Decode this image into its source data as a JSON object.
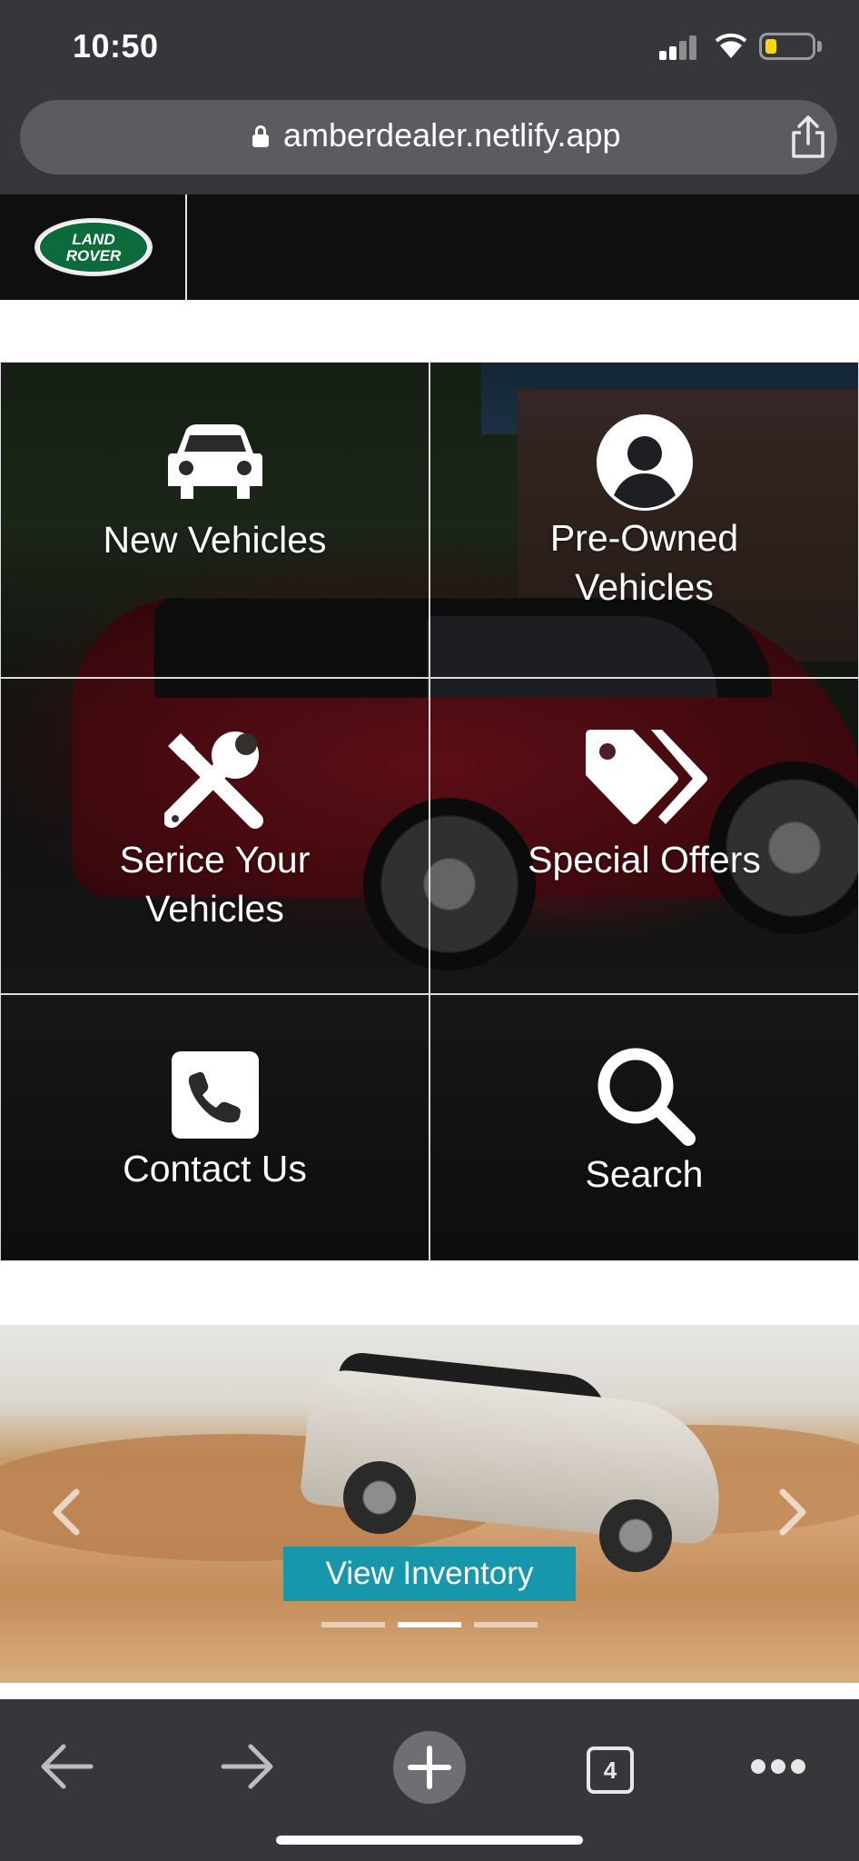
{
  "status_bar": {
    "time": "10:50",
    "battery_color": "#f5d90a"
  },
  "browser": {
    "url": "amberdealer.netlify.app",
    "tab_count": "4"
  },
  "site": {
    "logo_line1": "LAND",
    "logo_line2": "ROVER",
    "logo_colors": {
      "badge": "#0b6b3a",
      "border": "#c9c9c9"
    }
  },
  "tiles": [
    {
      "label_lines": [
        "New Vehicles"
      ],
      "icon": "car-icon"
    },
    {
      "label_lines": [
        "Pre-Owned",
        "Vehicles"
      ],
      "icon": "user-icon"
    },
    {
      "label_lines": [
        "Serice Your",
        "Vehicles"
      ],
      "icon": "tools-icon"
    },
    {
      "label_lines": [
        "Special Offers"
      ],
      "icon": "tags-icon"
    },
    {
      "label_lines": [
        "Contact Us"
      ],
      "icon": "phone-icon"
    },
    {
      "label_lines": [
        "Search"
      ],
      "icon": "search-icon"
    }
  ],
  "carousel": {
    "button_label": "View Inventory",
    "button_color": "#1797ab",
    "slide_count": 3,
    "active_slide": 2
  }
}
